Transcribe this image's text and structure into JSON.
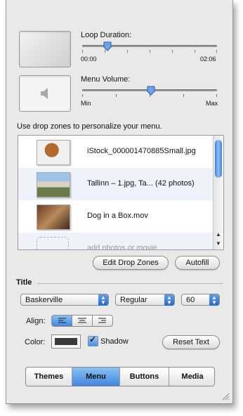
{
  "loop": {
    "label": "Loop Duration:",
    "min_label": "00:00",
    "max_label": "02:06",
    "value_fraction": 0.19
  },
  "volume": {
    "label": "Menu Volume:",
    "min_label": "Min",
    "max_label": "Max",
    "value_fraction": 0.51
  },
  "drop_zones": {
    "instructions": "Use drop zones to personalize your menu.",
    "items": [
      {
        "name": "iStock_000001470885Small.jpg"
      },
      {
        "name": "Tallinn – 1.jpg, Ta...  (42 photos)"
      },
      {
        "name": "Dog in a Box.mov"
      }
    ],
    "placeholder": "add photos or movie"
  },
  "buttons": {
    "edit_drop_zones": "Edit Drop Zones",
    "autofill": "Autofill",
    "reset_text": "Reset Text"
  },
  "title_section": {
    "heading": "Title",
    "font": "Baskerville",
    "style": "Regular",
    "size": "60",
    "align_label": "Align:",
    "color_label": "Color:",
    "shadow_label": "Shadow",
    "shadow_checked": true,
    "color_value": "#3a3a3a"
  },
  "tabs": [
    {
      "label": "Themes",
      "active": false
    },
    {
      "label": "Menu",
      "active": true
    },
    {
      "label": "Buttons",
      "active": false
    },
    {
      "label": "Media",
      "active": false
    }
  ],
  "colors": {
    "accent": "#3f86dd",
    "row_alt": "#eef3fb"
  }
}
